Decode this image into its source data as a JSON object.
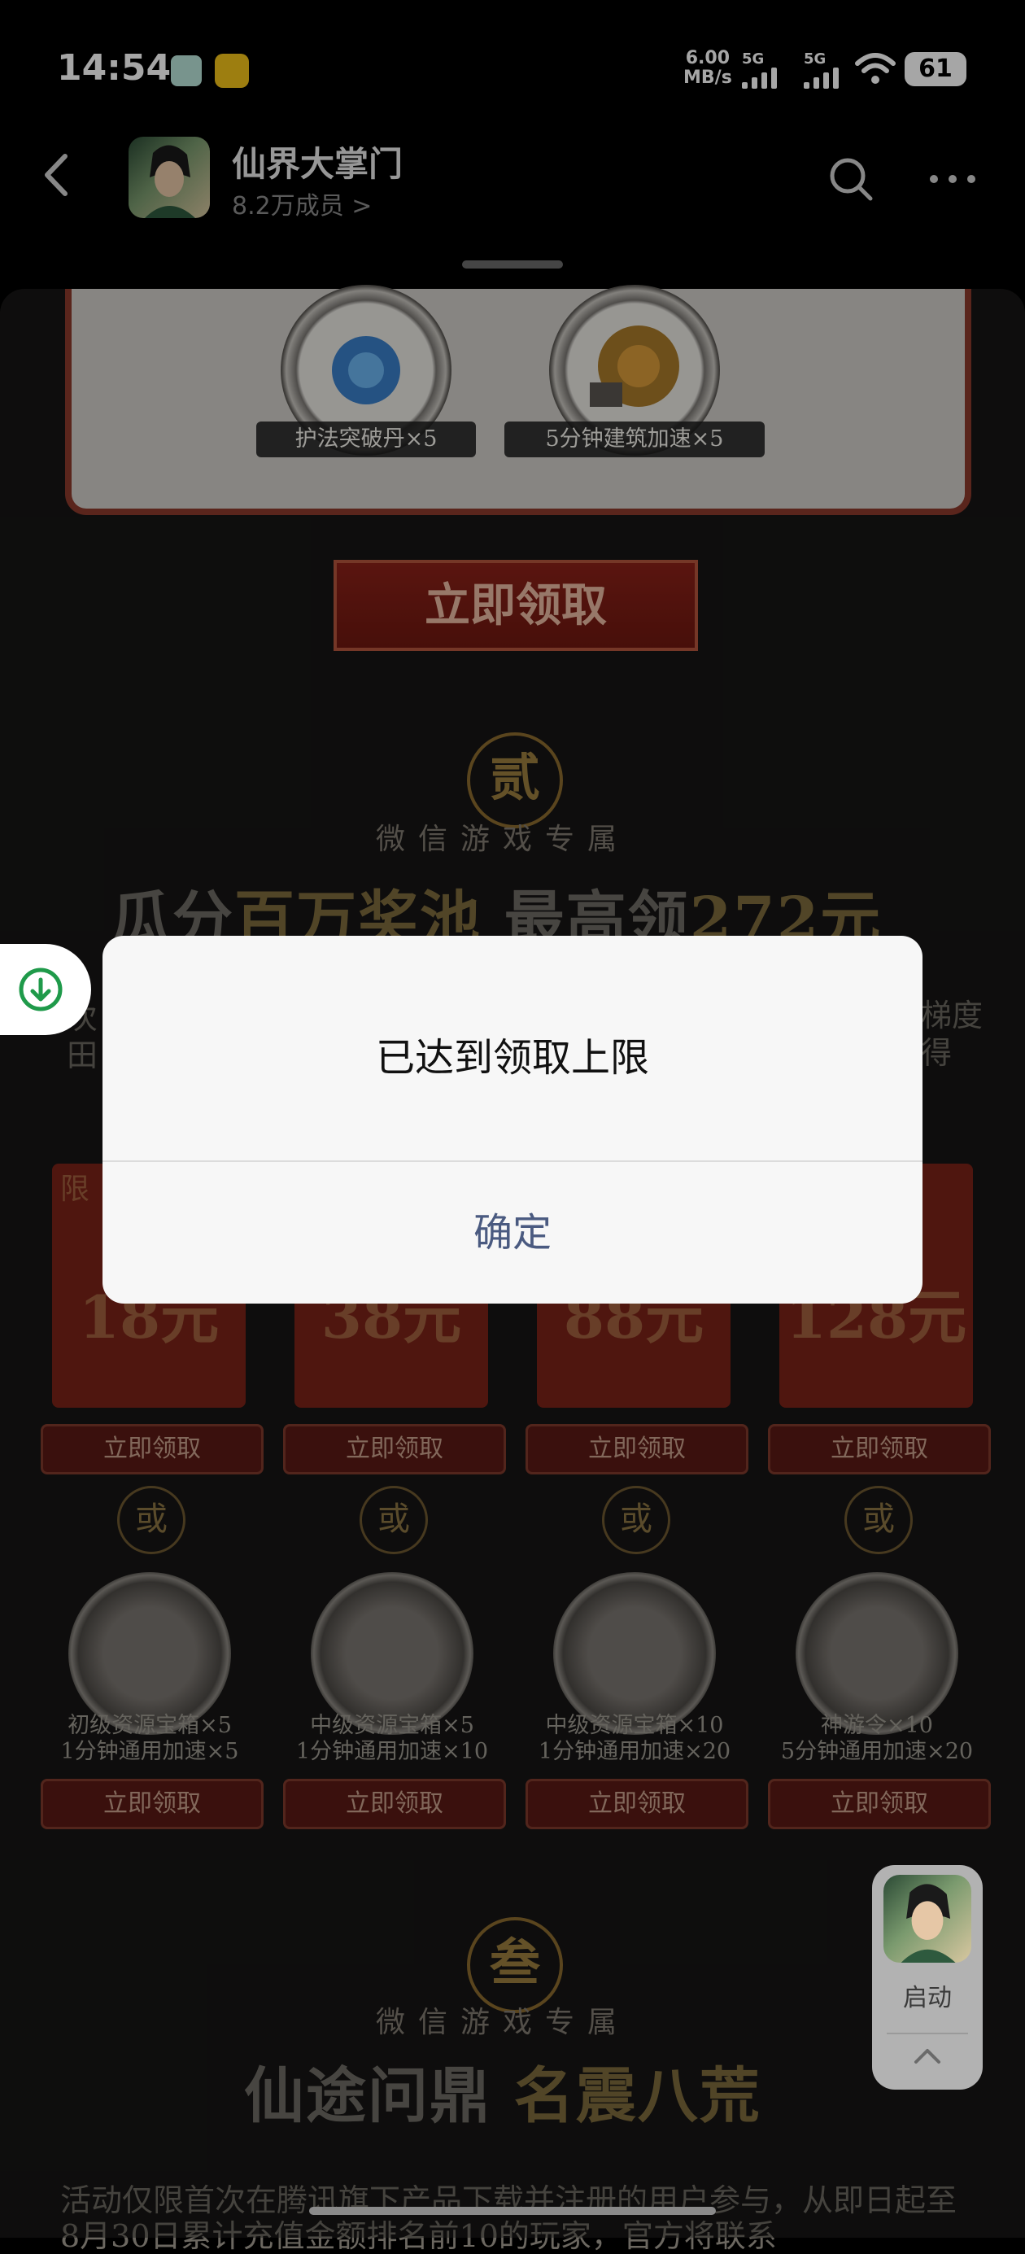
{
  "status_bar": {
    "time": "14:54",
    "net_speed_value": "6.00",
    "net_speed_unit": "MB/s",
    "sim1": "5G",
    "sim2": "5G",
    "battery": "61"
  },
  "header": {
    "community_name": "仙界大掌门",
    "member_count": "8.2万成员 >"
  },
  "background": {
    "rewards": [
      "护法突破丹×5",
      "5分钟建筑加速×5"
    ],
    "claim_now_big": "立即领取",
    "section2": {
      "badge": "贰",
      "subtitle": "微信游戏专属",
      "headline_a": "瓜分",
      "headline_b": "百万奖池",
      "headline_c": " 最高领",
      "headline_d": "272元",
      "side_left": "次\n田",
      "side_right": "梯度\n得",
      "limit_tag": "限",
      "tiers": [
        "18元",
        "38元",
        "88元",
        "128元"
      ],
      "claim_small": "立即领取",
      "or_label": "或",
      "items": [
        {
          "line1": "初级资源宝箱×5",
          "line2": "1分钟通用加速×5"
        },
        {
          "line1": "中级资源宝箱×5",
          "line2": "1分钟通用加速×10"
        },
        {
          "line1": "中级资源宝箱×10",
          "line2": "1分钟通用加速×20"
        },
        {
          "line1": "神游令×10",
          "line2": "5分钟通用加速×20"
        }
      ]
    },
    "section3": {
      "badge": "叁",
      "subtitle": "微信游戏专属",
      "headline_a": "仙途问鼎 ",
      "headline_b": "名震八荒"
    },
    "bottom_text": "活动仅限首次在腾讯旗下产品下载并注册的用户参与，从即日起至8月30日累计充值金额排名前10的玩家，官方将联系"
  },
  "launch_panel": {
    "label": "启动"
  },
  "dialog": {
    "message": "已达到领取上限",
    "confirm_label": "确定"
  },
  "colors": {
    "accent_green": "#1f9a4a",
    "dialog_button": "#4a5a80",
    "red_banner": "#7a2218"
  }
}
